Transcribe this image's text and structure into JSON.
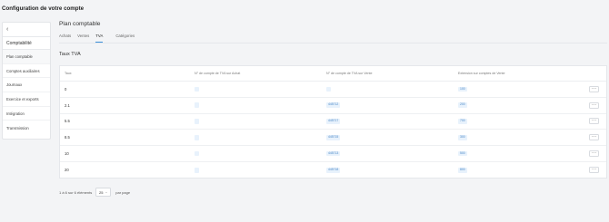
{
  "page": {
    "title": "Configuration de votre compte"
  },
  "sidebar": {
    "back_icon": "chevron-left-icon",
    "section": "Comptabilité",
    "items": [
      {
        "label": "Plan comptable",
        "active": true
      },
      {
        "label": "Comptes auxiliaires"
      },
      {
        "label": "Journaux"
      },
      {
        "label": "Exercice et exports"
      },
      {
        "label": "Intégration"
      },
      {
        "label": "Transmission"
      }
    ]
  },
  "main": {
    "title": "Plan comptable",
    "tabs": [
      {
        "label": "Achats"
      },
      {
        "label": "Ventes"
      },
      {
        "label": "TVA",
        "active": true
      },
      {
        "label": "Catégories"
      }
    ],
    "section_title": "Taux TVA"
  },
  "table": {
    "headers": [
      "Taux",
      "N° de compte de TVA sur Achat",
      "N° de compte de TVA sur Vente",
      "Extension sur comptes de Vente"
    ],
    "rows": [
      {
        "rate": "0",
        "buy": "",
        "sell": "",
        "ext": "100"
      },
      {
        "rate": "2.1",
        "buy": "",
        "sell": "445712",
        "ext": "200"
      },
      {
        "rate": "5.5",
        "buy": "",
        "sell": "445717",
        "ext": "700"
      },
      {
        "rate": "8.5",
        "buy": "",
        "sell": "445715",
        "ext": "300"
      },
      {
        "rate": "10",
        "buy": "",
        "sell": "445713",
        "ext": "500"
      },
      {
        "rate": "20",
        "buy": "",
        "sell": "445718",
        "ext": "800"
      }
    ],
    "row_action": "···"
  },
  "footer": {
    "range": "1 à 6 sur 6 éléments",
    "page_size": "25",
    "per_page": "par page"
  }
}
